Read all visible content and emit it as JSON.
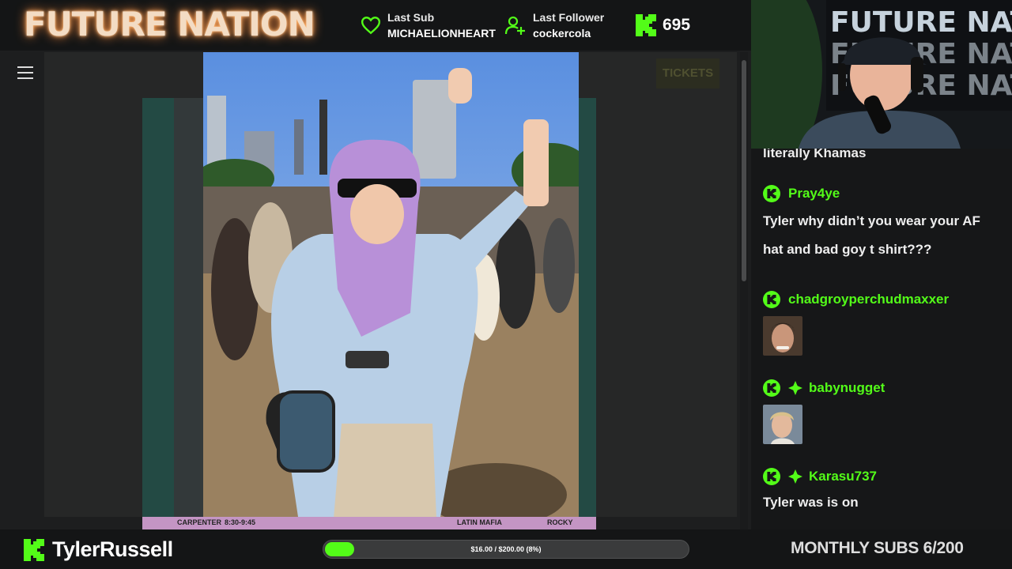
{
  "header": {
    "logo_text": "FUTURE NATION",
    "last_sub": {
      "label": "Last Sub",
      "value": "MICHAELIONHEART",
      "icon": "heart-icon"
    },
    "last_follower": {
      "label": "Last Follower",
      "value": "cockercola",
      "icon": "user-plus-icon"
    },
    "kick_viewers": {
      "icon": "kick-logo-icon",
      "value": "695"
    }
  },
  "stage": {
    "tickets_label": "TICKETS",
    "lineup": [
      "CARPENTER",
      "8:30-9:45",
      "LATIN MAFIA",
      "ROCKY"
    ]
  },
  "chat": {
    "partial_text": "literally Khamas",
    "messages": [
      {
        "user": "Pray4ye",
        "text": "Tyler why didn’t you wear your AF hat and bad goy t shirt???",
        "badges": [
          "kick-badge"
        ]
      },
      {
        "user": "chadgroyperchudmaxxer",
        "text": "",
        "emote": "emote-face-1",
        "badges": [
          "kick-badge"
        ]
      },
      {
        "user": "babynugget",
        "text": "",
        "emote": "emote-face-2",
        "badges": [
          "kick-badge",
          "diamond-badge"
        ]
      },
      {
        "user": "Karasu737",
        "text": "Tyler was is on",
        "badges": [
          "kick-badge",
          "diamond-badge"
        ]
      }
    ]
  },
  "footer": {
    "channel_name": "TylerRussell",
    "progress_text": "$16.00 / $200.00 (8%)",
    "progress_fraction": 0.08,
    "monthly_subs": "MONTHLY SUBS 6/200"
  },
  "colors": {
    "accent": "#53fc18",
    "logo_glow": "#ff8a3a",
    "background": "#111213"
  }
}
